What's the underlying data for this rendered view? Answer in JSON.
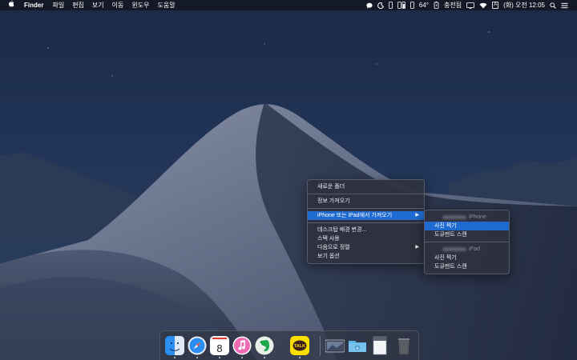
{
  "menubar": {
    "app_name": "Finder",
    "items": [
      "파일",
      "편집",
      "보기",
      "이동",
      "윈도우",
      "도움말"
    ],
    "status": {
      "temperature": "64°",
      "charging": "충전됨",
      "ime": "A",
      "clock": "(화) 오전 12:05"
    }
  },
  "context_menu": {
    "items": [
      {
        "label": "새로운 폴더"
      },
      {
        "label": "정보 가져오기"
      },
      {
        "label": "iPhone 또는 iPad에서 가져오기",
        "selected": true,
        "has_submenu": true
      },
      {
        "label": "데스크탑 배경 변경..."
      },
      {
        "label": "스택 사용"
      },
      {
        "label": "다음으로 정렬",
        "has_submenu": true
      },
      {
        "label": "보기 옵션"
      }
    ],
    "arrow": "▶"
  },
  "submenu": {
    "device1": "iPhone",
    "device1_items": [
      "사진 찍기",
      "도큐멘트 스캔"
    ],
    "device2": "iPad",
    "device2_items": [
      "사진 찍기",
      "도큐멘트 스캔"
    ],
    "selected": "사진 찍기"
  },
  "dock": {
    "icons": [
      "finder-icon",
      "safari-icon",
      "calendar-icon",
      "itunes-icon",
      "evernote-icon",
      "kakaotalk-icon",
      "screen-capture-icon",
      "downloads-folder-icon",
      "document-icon",
      "trash-icon"
    ],
    "calendar_day": "8",
    "kakao_label": "TALK"
  },
  "colors": {
    "selection": "#1f6ad0",
    "menu_bg": "#2e323e",
    "dock_bg": "#303644"
  }
}
